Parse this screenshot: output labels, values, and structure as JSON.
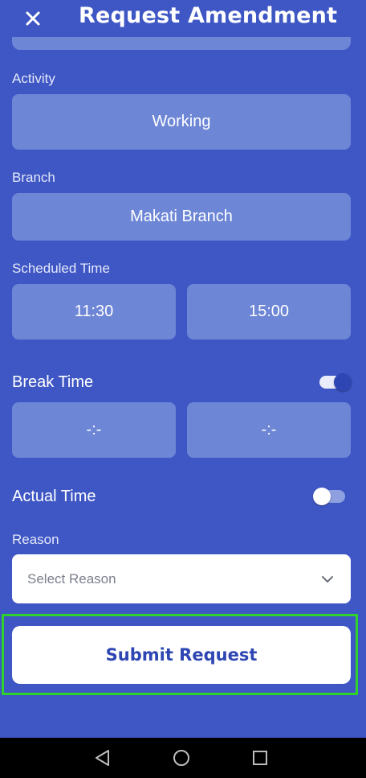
{
  "header": {
    "title": "Request Amendment",
    "close_icon": "close-icon"
  },
  "form": {
    "activity": {
      "label": "Activity",
      "value": "Working"
    },
    "branch": {
      "label": "Branch",
      "value": "Makati Branch"
    },
    "scheduled_time": {
      "label": "Scheduled Time",
      "start": "11:30",
      "end": "15:00"
    },
    "break_time": {
      "label": "Break Time",
      "toggle_on": true,
      "start": "-:-",
      "end": "-:-"
    },
    "actual_time": {
      "label": "Actual Time",
      "toggle_on": false
    },
    "reason": {
      "label": "Reason",
      "placeholder": "Select Reason",
      "icon": "chevron-down-icon"
    },
    "submit_label": "Submit Request"
  },
  "navbar": {
    "icons": [
      "back-icon",
      "home-icon",
      "recents-icon"
    ]
  },
  "colors": {
    "background": "#3F57C4",
    "field": "#6D86D6",
    "accent": "#2E46B3",
    "highlight": "#2FD12A"
  }
}
